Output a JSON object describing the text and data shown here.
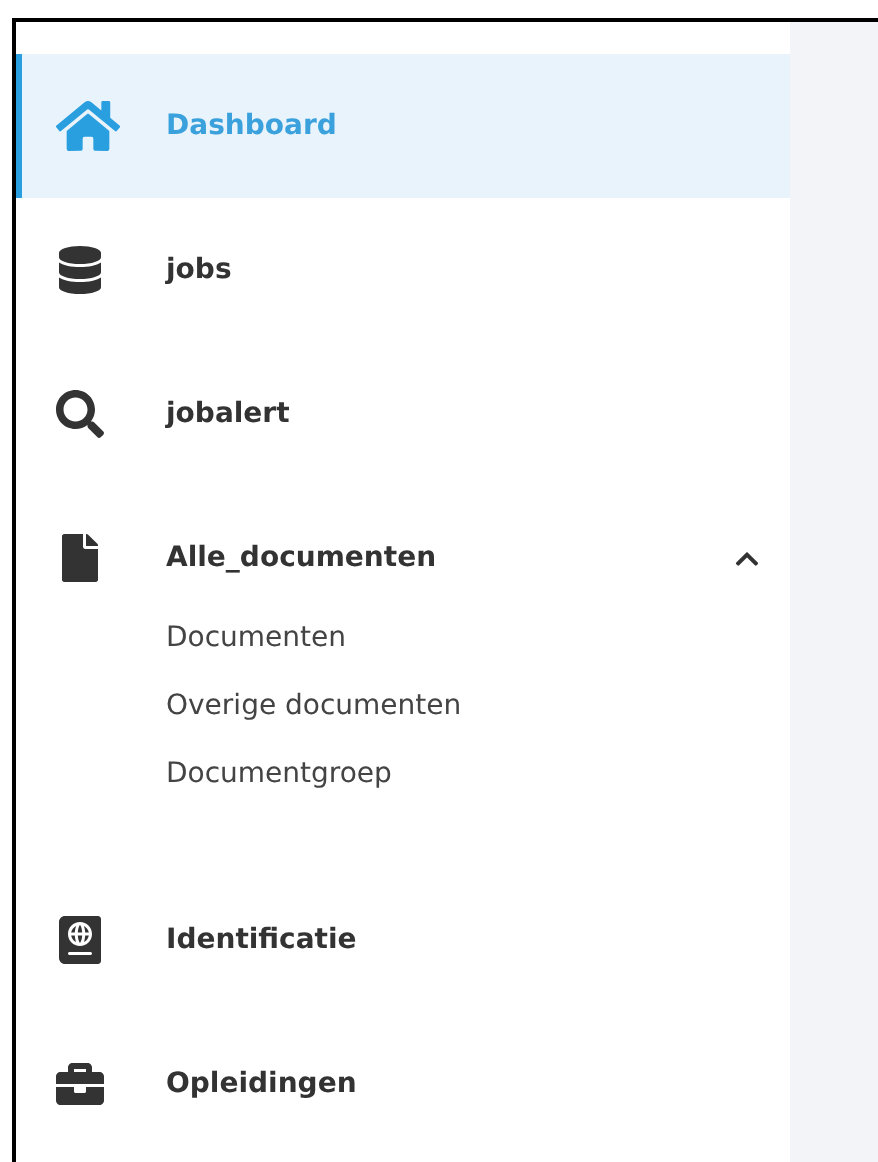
{
  "sidebar": {
    "items": [
      {
        "kind": "link",
        "label": "Dashboard",
        "selected": true
      },
      {
        "kind": "link",
        "label": "jobs",
        "selected": false
      },
      {
        "kind": "link",
        "label": "jobalert",
        "selected": false
      },
      {
        "kind": "group",
        "label": "Alle_documenten",
        "selected": false,
        "expanded": true,
        "children": [
          {
            "label": "Documenten"
          },
          {
            "label": "Overige documenten"
          },
          {
            "label": "Documentgroep"
          }
        ]
      },
      {
        "kind": "link",
        "label": "Identificatie",
        "selected": false
      },
      {
        "kind": "link",
        "label": "Opleidingen",
        "selected": false
      }
    ]
  }
}
